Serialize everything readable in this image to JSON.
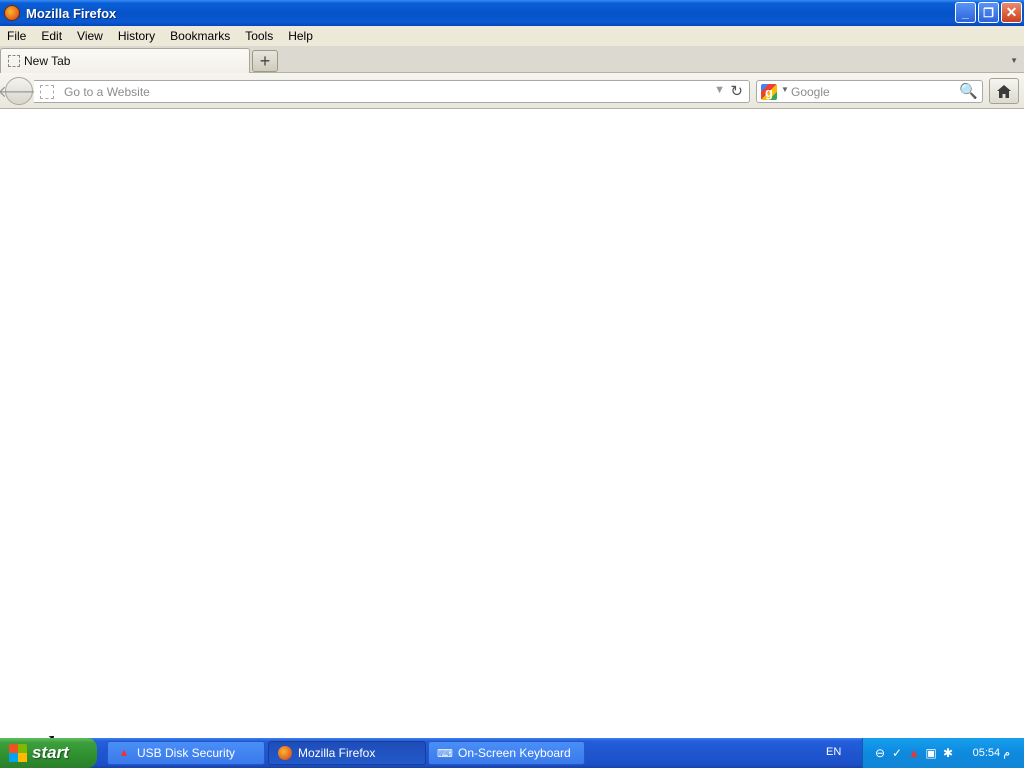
{
  "window": {
    "title": "Mozilla Firefox"
  },
  "menu": [
    "File",
    "Edit",
    "View",
    "History",
    "Bookmarks",
    "Tools",
    "Help"
  ],
  "tabs": [
    {
      "label": "New Tab"
    }
  ],
  "navbar": {
    "url_placeholder": "Go to a Website",
    "search_placeholder": "Google",
    "search_engine": "google-icon"
  },
  "taskbar": {
    "start_label": "start",
    "tasks": [
      {
        "label": "USB Disk Security",
        "icon": "usb-security-icon"
      },
      {
        "label": "Mozilla Firefox",
        "icon": "firefox-icon"
      },
      {
        "label": "On-Screen Keyboard",
        "icon": "keyboard-icon"
      }
    ],
    "language": "EN",
    "clock": "05:54 م"
  },
  "colors": {
    "title_bar": "#0653c9",
    "taskbar": "#245edb",
    "start": "#3c9f3c",
    "tray": "#0e8ade"
  }
}
